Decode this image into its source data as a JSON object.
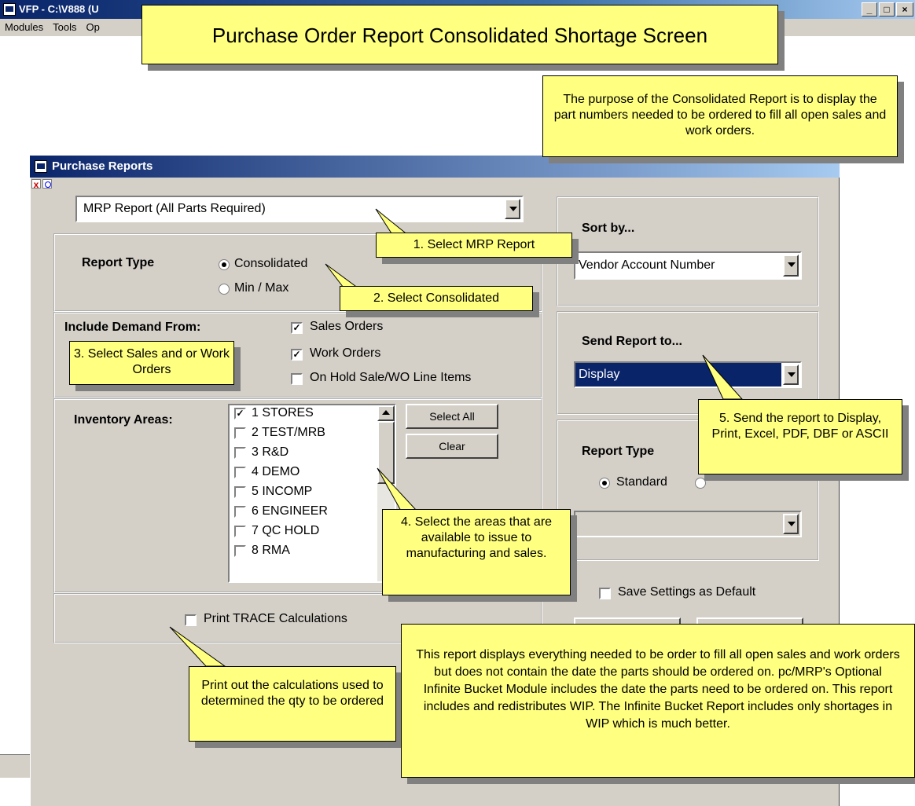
{
  "app": {
    "title": "VFP - C:\\V888  (U",
    "menu": [
      "Modules",
      "Tools",
      "Op"
    ]
  },
  "page_title_callout": "Purchase Order Report Consolidated Shortage Screen",
  "dialog": {
    "title": "Purchase Reports",
    "report_select": "MRP Report (All Parts Required)",
    "report_type": {
      "label": "Report Type",
      "options": [
        "Consolidated",
        "Min / Max"
      ],
      "selected": "Consolidated"
    },
    "demand": {
      "label": "Include Demand From:",
      "options": [
        {
          "label": "Sales Orders",
          "checked": true
        },
        {
          "label": "Work Orders",
          "checked": true
        },
        {
          "label": "On Hold Sale/WO Line Items",
          "checked": false
        }
      ]
    },
    "inventory": {
      "label": "Inventory Areas:",
      "areas": [
        {
          "label": "1  STORES",
          "checked": true
        },
        {
          "label": "2  TEST/MRB",
          "checked": false
        },
        {
          "label": "3  R&D",
          "checked": false
        },
        {
          "label": "4  DEMO",
          "checked": false
        },
        {
          "label": "5  INCOMP",
          "checked": false
        },
        {
          "label": "6  ENGINEER",
          "checked": false
        },
        {
          "label": "7  QC HOLD",
          "checked": false
        },
        {
          "label": "8  RMA",
          "checked": false
        }
      ],
      "select_all": "Select All",
      "clear": "Clear"
    },
    "trace": {
      "label": "Print TRACE Calculations",
      "checked": false
    },
    "sort_by": {
      "label": "Sort by...",
      "value": "Vendor Account Number"
    },
    "send_to": {
      "label": "Send Report to...",
      "value": "Display"
    },
    "right_report_type": {
      "label": "Report Type",
      "option": "Standard"
    },
    "save_default": {
      "label": "Save Settings as Default",
      "checked": false
    }
  },
  "callouts": {
    "purpose": "The purpose of the Consolidated Report is to display the part numbers needed to be ordered to fill all open sales and work orders.",
    "step1": "1. Select MRP Report",
    "step2": "2. Select Consolidated",
    "step3": "3. Select Sales and or Work Orders",
    "step4": "4. Select the areas that are available to issue to manufacturing and sales.",
    "step5": "5. Send the report to Display, Print, Excel, PDF, DBF or ASCII",
    "trace_note": "Print out the calculations used to determined the qty to be ordered",
    "bottom_note": "This report displays everything needed to be order to fill all open sales and work orders but does not contain the date the parts should be ordered on.    pc/MRP's Optional Infinite Bucket Module includes the date the parts need to be ordered on.  This report includes and redistributes WIP.  The Infinite Bucket Report includes only shortages in WIP which is much better."
  }
}
